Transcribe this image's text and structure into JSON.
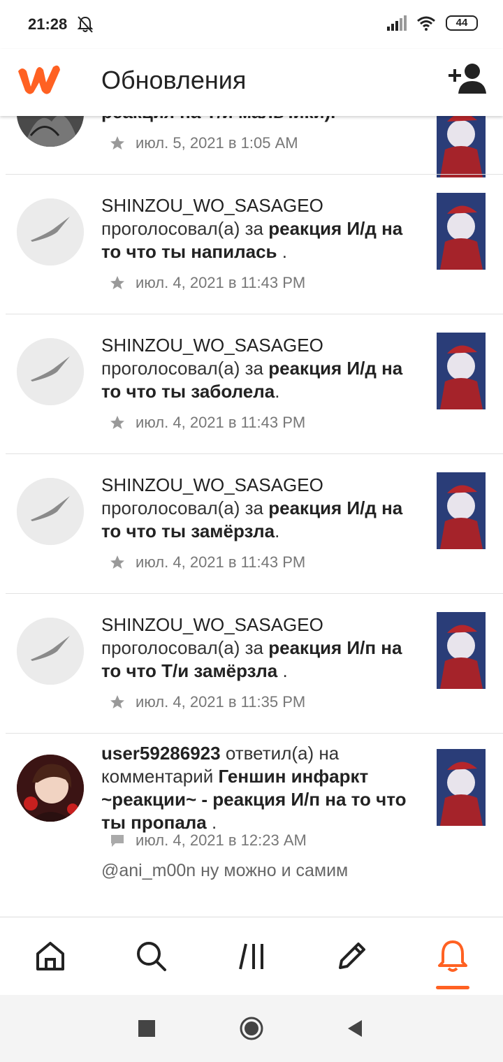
{
  "status_bar": {
    "time": "21:28",
    "battery": "44"
  },
  "app_bar": {
    "title": "Обновления"
  },
  "feed": {
    "partial_top": {
      "text": "реакция на Т/и мальчики).",
      "date": "июл. 5, 2021 в 1:05 AM"
    },
    "items": [
      {
        "user": "SHINZOU_WO_SASAGEO",
        "action": "проголосовал(а) за",
        "story": "реакция И/д на то что ты напилась",
        "tail": " .",
        "date": "июл. 4, 2021 в 11:43 PM"
      },
      {
        "user": "SHINZOU_WO_SASAGEO",
        "action": "проголосовал(а) за",
        "story": "реакция И/д на то что ты заболела",
        "tail": ".",
        "date": "июл. 4, 2021 в 11:43 PM"
      },
      {
        "user": "SHINZOU_WO_SASAGEO",
        "action": "проголосовал(а) за",
        "story": "реакция И/д на то что ты замёрзла",
        "tail": ".",
        "date": "июл. 4, 2021 в 11:43 PM"
      },
      {
        "user": "SHINZOU_WO_SASAGEO",
        "action": "проголосовал(а) за",
        "story": "реакция И/п на то что Т/и замёрзла",
        "tail": " .",
        "date": "июл. 4, 2021 в 11:35 PM"
      }
    ],
    "comment": {
      "user": "user59286923",
      "action": "ответил(а) на комментарий",
      "story": "Геншин инфаркт ~реакции~ - реакция И/п на то что ты пропала",
      "tail": " .",
      "date": "июл. 4, 2021 в 12:23 AM",
      "quote": "@ani_m00n  ну можно и самим"
    }
  },
  "colors": {
    "accent": "#ff6122",
    "text": "#222222",
    "meta": "#777777"
  },
  "icons": {
    "bottom_nav": [
      "home-icon",
      "search-icon",
      "library-icon",
      "write-icon",
      "notifications-icon"
    ],
    "system_nav": [
      "recents-icon",
      "home-circle-icon",
      "back-icon"
    ]
  }
}
